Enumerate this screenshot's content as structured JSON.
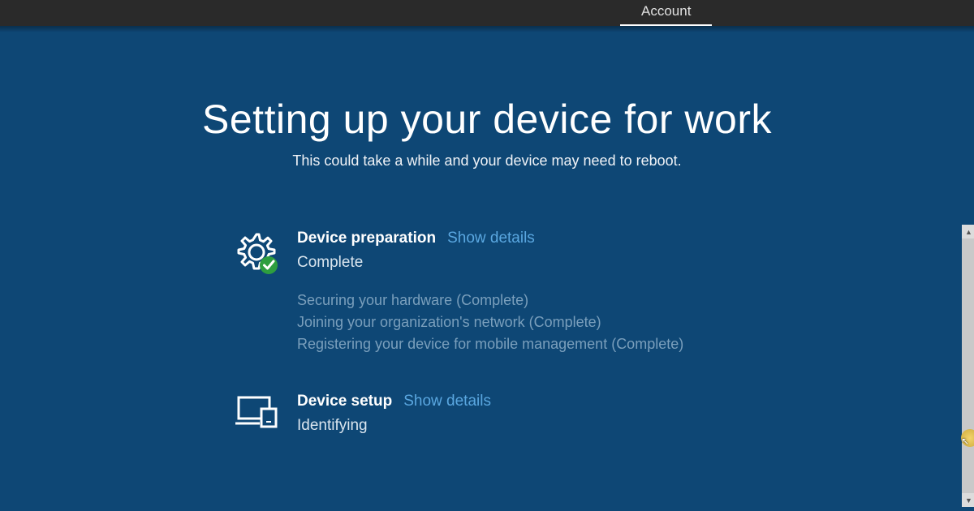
{
  "topbar": {
    "active_tab": "Account"
  },
  "page": {
    "title": "Setting up your device for work",
    "subtitle": "This could take a while and your device may need to reboot."
  },
  "sections": [
    {
      "title": "Device preparation",
      "link": "Show details",
      "status": "Complete",
      "sub": [
        "Securing your hardware (Complete)",
        "Joining your organization's network (Complete)",
        "Registering your device for mobile management (Complete)"
      ]
    },
    {
      "title": "Device setup",
      "link": "Show details",
      "status": "Identifying"
    }
  ]
}
